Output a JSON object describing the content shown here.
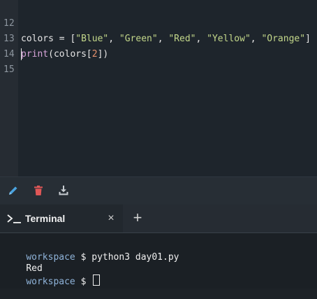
{
  "editor": {
    "lines": [
      {
        "number": "12",
        "prefix": "colors = [",
        "s1": "\"Blue\"",
        "sep1": ", ",
        "s2": "\"Green\"",
        "sep2": ", ",
        "s3": "\"Red\"",
        "sep3": ", ",
        "s4": "\"Yellow\"",
        "sep4": ", ",
        "s5": "\"Orange\"",
        "suffix": "]"
      },
      {
        "number": "13",
        "fn": "print",
        "open": "(colors[",
        "index": "2",
        "close": "])"
      },
      {
        "number": "14"
      },
      {
        "number": "15"
      }
    ]
  },
  "toolbar": {
    "edit_icon": "pencil-icon",
    "delete_icon": "trash-icon",
    "download_icon": "download-icon"
  },
  "terminal_tabs": {
    "active_label": "Terminal",
    "close_glyph": "×",
    "add_glyph": "+"
  },
  "terminal": {
    "lines": [
      {
        "prompt": "workspace",
        "symbol": " $ ",
        "command": "python3 day01.py"
      },
      {
        "output": "Red"
      },
      {
        "prompt": "workspace",
        "symbol": " $ ",
        "command": ""
      }
    ]
  },
  "colors": {
    "accent_blue": "#4aa3df",
    "delete_red": "#e05757"
  }
}
